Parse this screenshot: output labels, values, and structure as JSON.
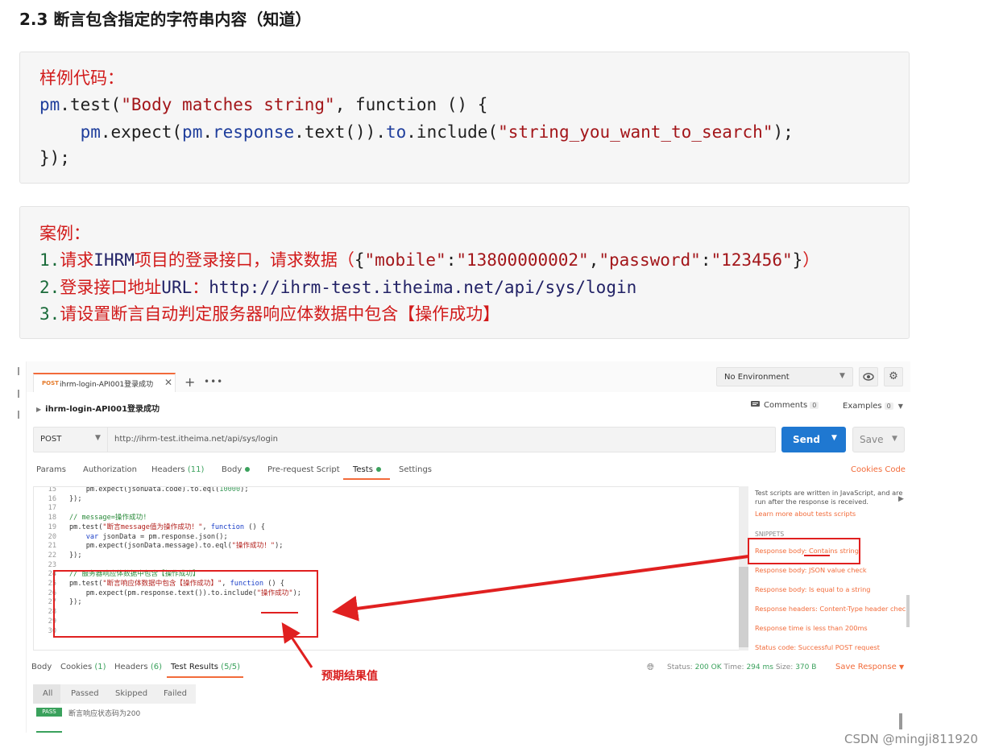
{
  "heading": "2.3 断言包含指定的字符串内容（知道）",
  "sample": {
    "label": "样例代码：",
    "l1_obj": "pm",
    "l1_dot": ".",
    "l1_fn": "test",
    "l1_paren": "(",
    "l1_str": "\"Body matches string\"",
    "l1_rest": ", function () {",
    "l2_a": "pm",
    "l2_b": ".",
    "l2_c": "expect",
    "l2_d": "(",
    "l2_e": "pm",
    "l2_f": ".",
    "l2_g": "response",
    "l2_h": ".",
    "l2_i": "text",
    "l2_j": "()).",
    "l2_k": "to",
    "l2_l": ".",
    "l2_m": "include",
    "l2_n": "(",
    "l2_o": "\"string_you_want_to_search\"",
    "l2_p": ");",
    "l3": "});"
  },
  "case": {
    "label": "案例：",
    "l1_num": "1.",
    "l1_a": "请求",
    "l1_b": "IHRM",
    "l1_c": "项目的登录接口，请求数据（",
    "l1_d": "{",
    "l1_e": "\"mobile\"",
    "l1_f": ":",
    "l1_g": "\"13800000002\"",
    "l1_h": ",",
    "l1_i": "\"password\"",
    "l1_j": ":",
    "l1_k": "\"123456\"",
    "l1_l": "}",
    "l1_m": "）",
    "l2_num": "2.",
    "l2_a": "登录接口地址",
    "l2_b": "URL",
    "l2_c": "：",
    "l2_d": "http://ihrm-test.itheima.net/api/sys/login",
    "l3_num": "3.",
    "l3_a": "请设置断言自动判定服务器响应体数据中包含【操作成功】"
  },
  "postman": {
    "tab": {
      "method": "POST",
      "title": "ihrm-login-API001登录成功",
      "close": "✕"
    },
    "plus": "+",
    "more": "•••",
    "environment": "No Environment",
    "request_name": "ihrm-login-API001登录成功",
    "comments_label": "Comments",
    "comments_count": "0",
    "examples_label": "Examples",
    "examples_count": "0",
    "method": "POST",
    "url": "http://ihrm-test.itheima.net/api/sys/login",
    "send": "Send",
    "save": "Save",
    "tabs": {
      "params": "Params",
      "authorization": "Authorization",
      "headers": "Headers",
      "headers_count": "(11)",
      "body": "Body",
      "prerequest": "Pre-request Script",
      "tests": "Tests",
      "settings": "Settings"
    },
    "cookies": "Cookies",
    "code": "Code",
    "editor": {
      "n15": "15",
      "t15a": "    pm.expect(jsonData.code).to.eql(",
      "t15b": "10000",
      "t15c": ");",
      "n16": "16",
      "t16": "});",
      "n17": "17",
      "n18": "18",
      "t18": "// message=操作成功!",
      "n19": "19",
      "t19a": "pm.test(",
      "t19b": "\"断言message值为操作成功！\"",
      "t19c": ", ",
      "t19d": "function",
      "t19e": " () {",
      "n20": "20",
      "t20a": "    ",
      "t20b": "var",
      "t20c": " jsonData = pm.response.json();",
      "n21": "21",
      "t21a": "    pm.expect(jsonData.message).to.eql(",
      "t21b": "\"操作成功！\"",
      "t21c": ");",
      "n22": "22",
      "t22": "});",
      "n23": "23",
      "n24": "24",
      "t24": "// 服务器响应体数据中包含【操作成功】",
      "n25": "25",
      "t25a": "pm.test(",
      "t25b": "\"断言响应体数据中包含【操作成功】\"",
      "t25c": ", ",
      "t25d": "function",
      "t25e": " () {",
      "n26": "26",
      "t26a": "    pm.expect(pm.response.text()).to.include(",
      "t26b": "\"操作成功\"",
      "t26c": ");",
      "n27": "27",
      "t27": "});",
      "n28": "28",
      "n29": "29",
      "n30": "30"
    },
    "side": {
      "help": "Test scripts are written in JavaScript, and are run after the response is received.",
      "learn": "Learn more about tests scripts",
      "snippets_header": "SNIPPETS",
      "s1": "Response body: Contains string",
      "s2": "Response body: JSON value check",
      "s3": "Response body: Is equal to a string",
      "s4": "Response headers: Content-Type header check",
      "s5": "Response time is less than 200ms",
      "s6": "Status code: Successful POST request"
    },
    "response_tabs": {
      "body": "Body",
      "cookies": "Cookies",
      "cookies_count": "(1)",
      "headers": "Headers",
      "headers_count": "(6)",
      "test_results": "Test Results",
      "test_results_count": "(5/5)"
    },
    "status_label": "Status:",
    "status_value": "200 OK",
    "time_label": "Time:",
    "time_value": "294 ms",
    "size_label": "Size:",
    "size_value": "370 B",
    "save_response": "Save Response",
    "filters": {
      "all": "All",
      "passed": "Passed",
      "skipped": "Skipped",
      "failed": "Failed"
    },
    "result_badge": "PASS",
    "result_text": "断言响应状态码为200"
  },
  "annotation": "预期结果值",
  "watermark": "CSDN @mingji811920",
  "colors": {
    "accent": "#f26b3a",
    "send": "#1f78d1",
    "annotation_red": "#e02020",
    "pass_green": "#3aa15c"
  }
}
